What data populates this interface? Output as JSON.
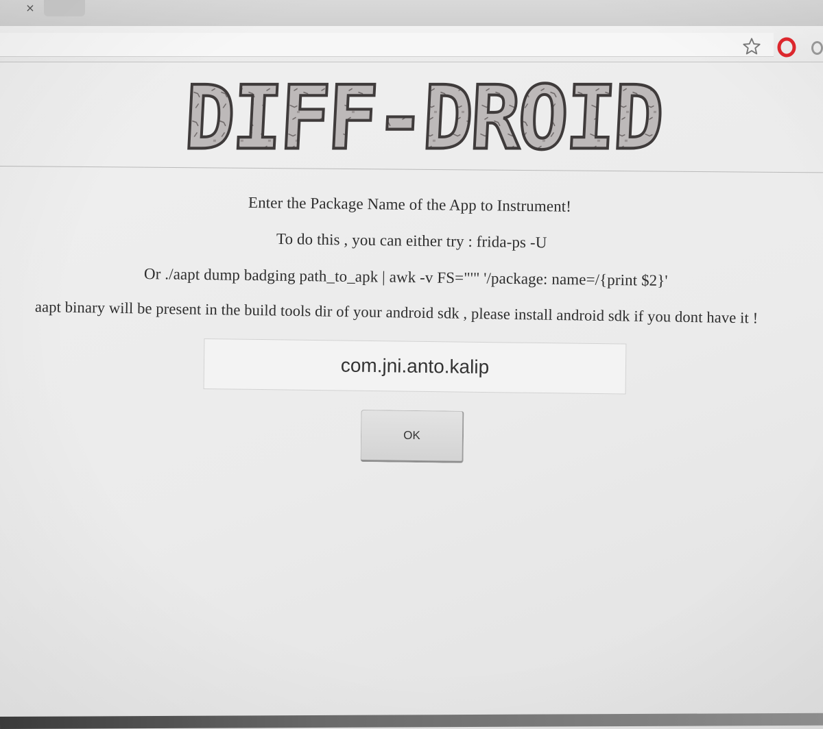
{
  "browser": {
    "tab_close_glyph": "×",
    "toolbar_icons": [
      "star-icon",
      "opera-icon",
      "extension-icon"
    ],
    "opera_red": "#e0282e"
  },
  "header": {
    "logo_text": "DIFF-DROID",
    "logo_colors": {
      "stone": "#b8b4b4",
      "outline": "#4a4a4a"
    }
  },
  "instructions": {
    "line1": "Enter the Package Name of the App to Instrument!",
    "line2": "To do this , you can either try : frida-ps -U",
    "line3": "Or ./aapt dump badging path_to_apk | awk -v FS=\"'\" '/package: name=/{print $2}'",
    "line4": "aapt binary will be present in the build tools dir of your android sdk , please install android sdk if you dont have it !"
  },
  "form": {
    "package_value": "com.jni.anto.kalip",
    "ok_label": "OK"
  }
}
